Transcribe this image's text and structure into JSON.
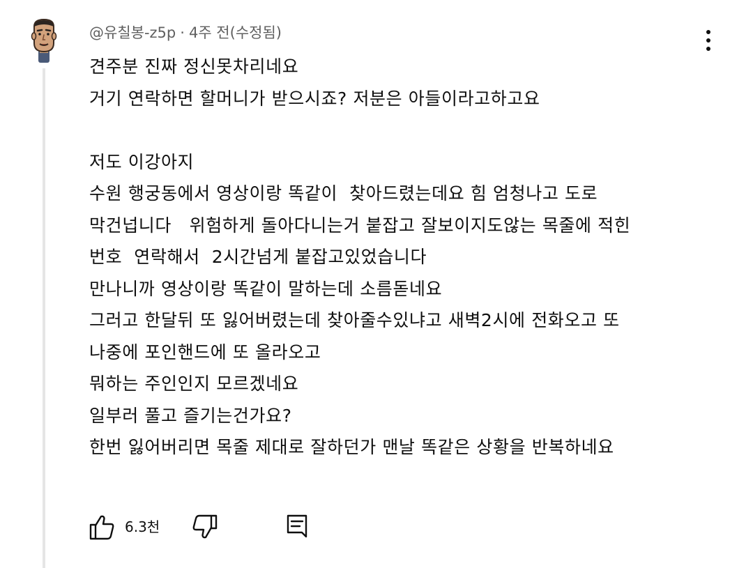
{
  "comment": {
    "author": "@유칠봉-z5p",
    "separator": "·",
    "time": "4주 전(수정됨)",
    "avatar_icon": "cartoon-face-avatar",
    "lines": [
      "견주분 진짜 정신못차리네요",
      "거기 연락하면 할머니가 받으시죠? 저분은 아들이라고하고요",
      "",
      "저도 이강아지",
      "수원 행궁동에서 영상이랑 똑같이  찾아드렸는데요 힘 엄청나고 도로",
      "막건넙니다   위험하게 돌아다니는거 붙잡고 잘보이지도않는 목줄에 적힌",
      "번호  연락해서  2시간넘게 붙잡고있었습니다",
      "만나니까 영상이랑 똑같이 말하는데 소름돋네요",
      "그러고 한달뒤 또 잃어버렸는데 찾아줄수있냐고 새벽2시에 전화오고 또",
      "나중에 포인핸드에 또 올라오고",
      "뭐하는 주인인지 모르겠네요",
      "일부러 풀고 즐기는건가요?",
      "한번 잃어버리면 목줄 제대로 잘하던가 맨날 똑같은 상황을 반복하네요"
    ],
    "actions": {
      "like_icon": "thumbs-up-icon",
      "like_count": "6.3천",
      "dislike_icon": "thumbs-down-icon",
      "reply_icon": "reply-icon",
      "more_icon": "more-vertical-icon"
    }
  }
}
